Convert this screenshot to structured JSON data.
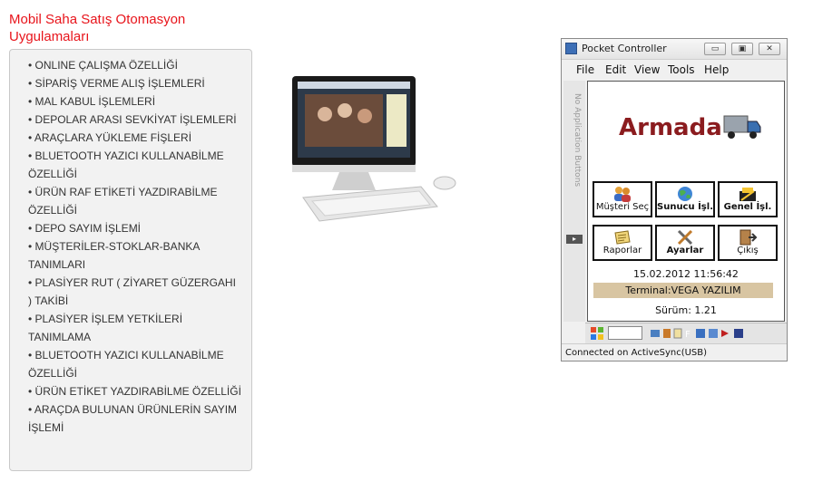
{
  "page": {
    "title": "Mobil Saha Satış Otomasyon Uygulamaları"
  },
  "features": [
    "ONLINE ÇALIŞMA ÖZELLİĞİ",
    "SİPARİŞ VERME ALIŞ İŞLEMLERİ",
    "MAL KABUL İŞLEMLERİ",
    "DEPOLAR ARASI SEVKİYAT İŞLEMLERİ",
    "ARAÇLARA YÜKLEME FİŞLERİ",
    "BLUETOOTH YAZICI KULLANABİLME ÖZELLİĞİ",
    "ÜRÜN RAF ETİKETİ YAZDIRABİLME ÖZELLİĞİ",
    "DEPO SAYIM İŞLEMİ",
    "MÜŞTERİLER-STOKLAR-BANKA TANIMLARI",
    "PLASİYER RUT ( ZİYARET GÜZERGAHI ) TAKİBİ",
    "PLASİYER İŞLEM YETKİLERİ TANIMLAMA",
    "BLUETOOTH YAZICI KULLANABİLME ÖZELLİĞİ",
    "ÜRÜN ETİKET YAZDIRABİLME ÖZELLİĞİ",
    "ARAÇDA BULUNAN ÜRÜNLERİN SAYIM İŞLEMİ"
  ],
  "pocket_controller": {
    "window_title": "Pocket Controller",
    "menu": [
      "File",
      "Edit",
      "View",
      "Tools",
      "Help"
    ],
    "side_label": "No Application Buttons",
    "brand": "Armada",
    "tiles": [
      {
        "label": "Müşteri Seç",
        "icon": "users-icon"
      },
      {
        "label": "Sunucu İşl.",
        "icon": "globe-icon"
      },
      {
        "label": "Genel İşl.",
        "icon": "tools-box-icon"
      },
      {
        "label": "Raporlar",
        "icon": "report-icon"
      },
      {
        "label": "Ayarlar",
        "icon": "wrench-icon"
      },
      {
        "label": "Çıkış",
        "icon": "exit-door-icon"
      }
    ],
    "datetime": "15.02.2012 11:56:42",
    "terminal": "Terminal:VEGA YAZILIM",
    "version": "Sürüm: 1.21",
    "status": "Connected on ActiveSync(USB)"
  },
  "colors": {
    "title_red": "#e8141b",
    "brand_red": "#8b1c1f",
    "terminal_bg": "#d8c5a2"
  }
}
